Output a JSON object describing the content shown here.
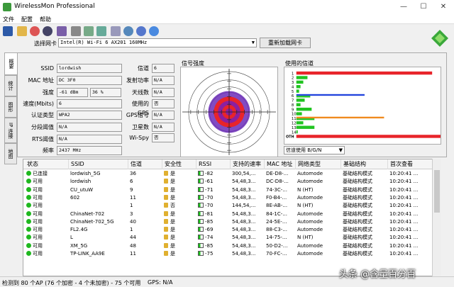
{
  "window": {
    "title": "WirelessMon Professional",
    "min": "—",
    "max": "☐",
    "close": "✕"
  },
  "menu": [
    "文件",
    "配置",
    "帮助"
  ],
  "toolbar_icons": [
    "save-icon",
    "open-icon",
    "record-icon",
    "stop-icon",
    "network-icon",
    "print-icon",
    "copy-icon",
    "clipboard-icon",
    "info-icon",
    "globe-icon",
    "refresh-icon",
    "help-icon"
  ],
  "adapter": {
    "label": "选择网卡",
    "value": "Intel(R) Wi-Fi 6 AX201 160MHz",
    "reload": "重新加载网卡"
  },
  "tabs": [
    "概要",
    "统计",
    "图形",
    "IP 连接",
    "地图"
  ],
  "info_left": [
    {
      "label": "SSID",
      "value": "lordwish"
    },
    {
      "label": "MAC 地址",
      "value": "DC                3F0"
    },
    {
      "label": "强度",
      "value": "-61 dBm",
      "value2": "36 %"
    },
    {
      "label": "速度(Mbits)",
      "value": "6"
    },
    {
      "label": "认证类型",
      "value": "WPA2"
    },
    {
      "label": "分段阈值",
      "value": "N/A"
    },
    {
      "label": "RTS阈值",
      "value": "N/A"
    },
    {
      "label": "频率",
      "value": "2437 MHz"
    }
  ],
  "info_right": [
    {
      "label": "信道",
      "value": "6"
    },
    {
      "label": "发射功率",
      "value": "N/A"
    },
    {
      "label": "天线数",
      "value": "N/A"
    },
    {
      "label": "使用的GPS",
      "value": "否"
    },
    {
      "label": "GPS信号",
      "value": "N/A"
    },
    {
      "label": "卫星数",
      "value": "N/A"
    },
    {
      "label": "Wi-Spy",
      "value": "否"
    }
  ],
  "radar": {
    "title": "信号强度"
  },
  "channels": {
    "title": "使用的信道",
    "labels": [
      "1",
      "2",
      "3",
      "4",
      "5",
      "6",
      "7",
      "8",
      "9",
      "10",
      "11",
      "12",
      "13",
      "14",
      "OTH"
    ],
    "selector": "信道使用 B/G/N"
  },
  "colors": {
    "red": "#e8242a",
    "green": "#21c421",
    "blue": "#2244dd",
    "orange": "#f08a1e"
  },
  "table": {
    "columns": [
      "状态",
      "SSID",
      "信道",
      "安全性",
      "RSSI",
      "支持的速率",
      "MAC 地址",
      "网络类型",
      "基础结构",
      "首次查看"
    ],
    "rows": [
      {
        "status": "已连接",
        "ssid": "lordwish_5G",
        "ch": "36",
        "sec": "是",
        "rssi": "-82",
        "rate": "300,54,...",
        "mac": "DE-D8-...",
        "type": "Automode",
        "infra": "基础结构模式",
        "first": "10:20:41 ..."
      },
      {
        "status": "可用",
        "ssid": "lordwish",
        "ch": "6",
        "sec": "是",
        "rssi": "-61",
        "rate": "54,48,3...",
        "mac": "DC-D8-...",
        "type": "Automode",
        "infra": "基础结构模式",
        "first": "10:20:41 ..."
      },
      {
        "status": "可用",
        "ssid": "CU_utuW",
        "ch": "9",
        "sec": "是",
        "rssi": "-71",
        "rate": "54,48,3...",
        "mac": "74-3C-...",
        "type": "N (HT)",
        "infra": "基础结构模式",
        "first": "10:20:41 ..."
      },
      {
        "status": "可用",
        "ssid": "602",
        "ch": "11",
        "sec": "是",
        "rssi": "-70",
        "rate": "54,48,3...",
        "mac": "F0-B4-...",
        "type": "Automode",
        "infra": "基础结构模式",
        "first": "10:20:41 ..."
      },
      {
        "status": "可用",
        "ssid": "",
        "ch": "1",
        "sec": "否",
        "rssi": "-70",
        "rate": "144,54,...",
        "mac": "8E-AB-...",
        "type": "N (HT)",
        "infra": "基础结构模式",
        "first": "10:20:41 ..."
      },
      {
        "status": "可用",
        "ssid": "ChinaNet-702",
        "ch": "3",
        "sec": "是",
        "rssi": "-81",
        "rate": "54,48,3...",
        "mac": "84-1C-...",
        "type": "Automode",
        "infra": "基础结构模式",
        "first": "10:20:41 ..."
      },
      {
        "status": "可用",
        "ssid": "ChinaNet-702_5G",
        "ch": "40",
        "sec": "是",
        "rssi": "-85",
        "rate": "54,48,3...",
        "mac": "24-5E-...",
        "type": "Automode",
        "infra": "基础结构模式",
        "first": "10:20:41 ..."
      },
      {
        "status": "可用",
        "ssid": "FL2.4G",
        "ch": "1",
        "sec": "是",
        "rssi": "-69",
        "rate": "54,48,3...",
        "mac": "88-C3-...",
        "type": "Automode",
        "infra": "基础结构模式",
        "first": "10:20:41 ..."
      },
      {
        "status": "可用",
        "ssid": "L",
        "ch": "44",
        "sec": "是",
        "rssi": "-74",
        "rate": "54,48,3...",
        "mac": "14-75-...",
        "type": "N (HT)",
        "infra": "基础结构模式",
        "first": "10:20:41 ..."
      },
      {
        "status": "可用",
        "ssid": "XM_5G",
        "ch": "48",
        "sec": "是",
        "rssi": "-85",
        "rate": "54,48,3...",
        "mac": "50-D2-...",
        "type": "Automode",
        "infra": "基础结构模式",
        "first": "10:20:41 ..."
      },
      {
        "status": "可用",
        "ssid": "TP-LINK_AA9E",
        "ch": "11",
        "sec": "是",
        "rssi": "-75",
        "rate": "54,48,3...",
        "mac": "70-FC-...",
        "type": "Automode",
        "infra": "基础结构模式",
        "first": "10:20:41 ..."
      }
    ]
  },
  "status": {
    "left": "检测到 80 个AP (76 个加密 - 4 个未加密) - 75 个可用",
    "gps": "GPS: N/A"
  },
  "watermark": "头条 @含量百分百"
}
